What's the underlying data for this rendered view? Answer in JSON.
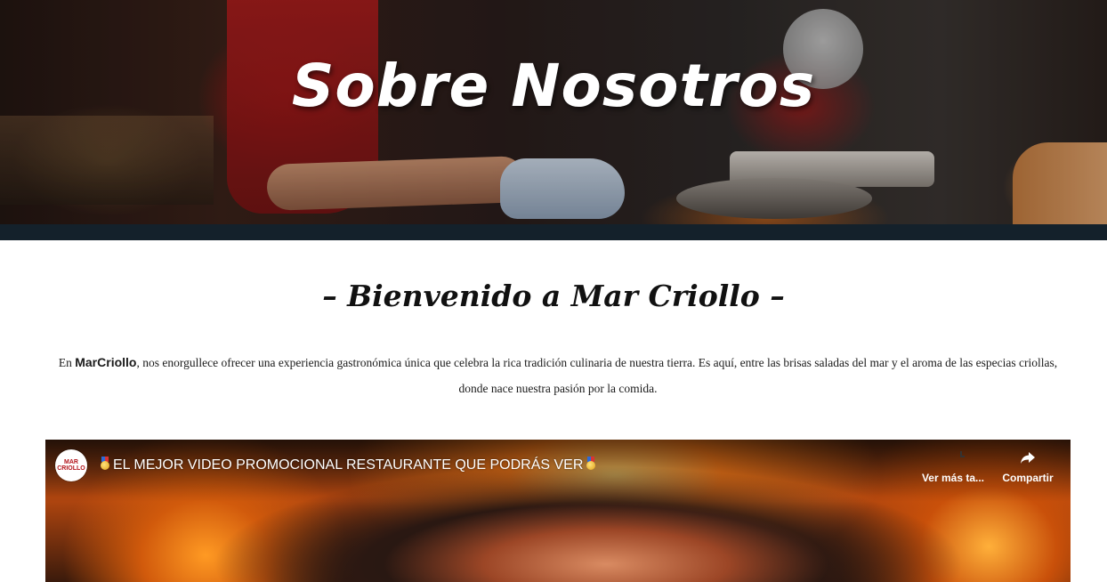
{
  "hero": {
    "title": "Sobre Nosotros"
  },
  "welcome": {
    "heading": "– Bienvenido a Mar Criollo –",
    "intro_prefix": "En ",
    "intro_brand": "MarCriollo",
    "intro_text": ", nos enorgullece ofrecer una experiencia gastronómica única que celebra la rica tradición culinaria de nuestra tierra. Es aquí, entre las brisas saladas del mar y el aroma de las especias criollas, donde nace nuestra pasión por la comida."
  },
  "video": {
    "channel_logo_text": "MAR CRIOLLO",
    "title": "EL MEJOR VIDEO PROMOCIONAL RESTAURANTE QUE PODRÁS VER",
    "title_icon": "medal-icon",
    "watch_later_label": "Ver más ta...",
    "watch_later_icon": "clock-icon",
    "share_label": "Compartir",
    "share_icon": "share-arrow-icon"
  },
  "colors": {
    "hero_band": "#14212b",
    "background": "#ffffff",
    "text": "#1b1b1b",
    "accent_red": "#b3151c"
  }
}
